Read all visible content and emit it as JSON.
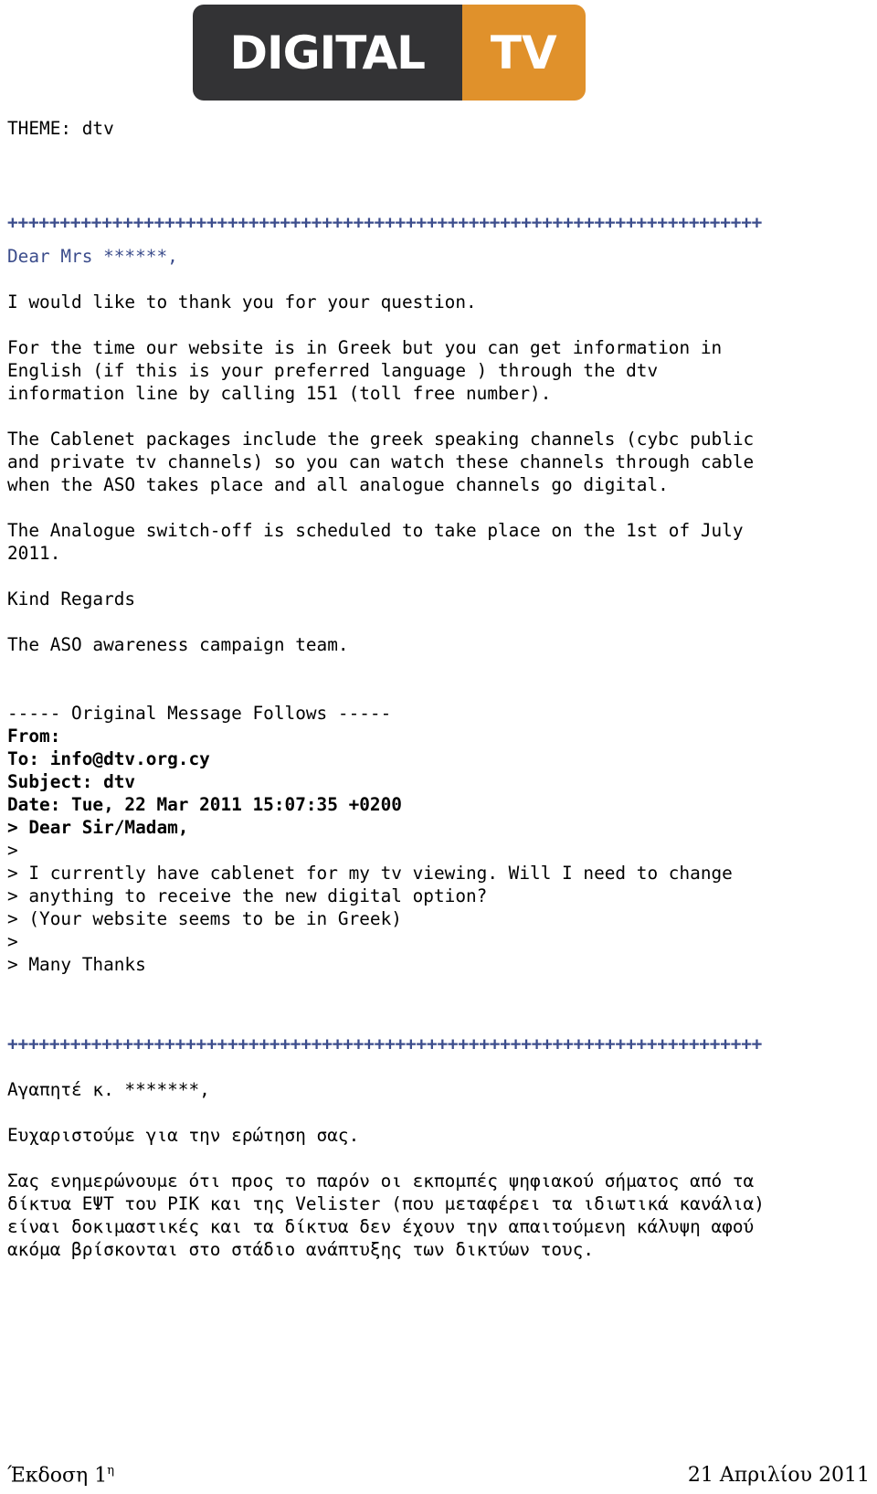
{
  "logo": {
    "name": "digital-tv-logo",
    "left_text": "DIGITAL",
    "right_text": "TV",
    "dark_color": "#333335",
    "orange_color": "#e0912b",
    "text_color": "#ffffff"
  },
  "colors": {
    "body_text": "#000000",
    "accent_blue": "#3c4d8c",
    "page_background": "#ffffff"
  },
  "theme_line": "THEME: dtv",
  "separator_top": "++++++++++++++++++++++++++++++++++++++++++++++++++++++++++++++++++++++++",
  "separator_bottom": "++++++++++++++++++++++++++++++++++++++++++++++++++++++++++++++++++++++++",
  "reply": {
    "salutation": "Dear Mrs ******,",
    "thanks_line": "I would like to thank you for your question.",
    "paragraph_1": "For the time our website is in Greek but you can get information in\nEnglish (if this is your preferred language ) through the dtv\ninformation line by calling 151 (toll free number).",
    "paragraph_2": "The Cablenet packages include the greek speaking channels (cybc public\nand private tv channels) so you can watch these channels through cable\nwhen the ASO takes place and all analogue channels go digital.",
    "paragraph_3": "The Analogue switch-off is scheduled to take place on the 1st of July\n2011.",
    "closing": "Kind Regards",
    "signature": "The ASO awareness campaign team."
  },
  "original_message": {
    "divider": "----- Original Message Follows -----",
    "from": "From:",
    "to": "To: info@dtv.org.cy",
    "subject": "Subject: dtv",
    "date": "Date: Tue, 22 Mar 2011 15:07:35 +0200",
    "quoted_salutation": "> Dear Sir/Madam,",
    "quoted_blank_1": ">",
    "quoted_body_1": "> I currently have cablenet for my tv viewing. Will I need to change\n> anything to receive the new digital option?\n> (Your website seems to be in Greek)",
    "quoted_blank_2": ">",
    "quoted_thanks": "> Many Thanks"
  },
  "greek": {
    "salutation": "Αγαπητέ κ. *******,",
    "thanks_line": "Ευχαριστούμε για την ερώτηση σας.",
    "paragraph_1": "Σας ενημερώνουμε ότι προς το παρόν οι εκπομπές ψηφιακού σήματος από τα\nδίκτυα ΕΨΤ του ΡΙΚ και της Velister (που μεταφέρει τα ιδιωτικά κανάλια)\nείναι δοκιμαστικές και τα δίκτυα δεν έχουν την απαιτούμενη κάλυψη αφού\nακόμα βρίσκονται στο στάδιο ανάπτυξης των δικτύων τους."
  },
  "footer": {
    "edition_prefix": "Έκδοση 1",
    "edition_suffix": "η",
    "date": "21 Απριλίου 2011"
  }
}
